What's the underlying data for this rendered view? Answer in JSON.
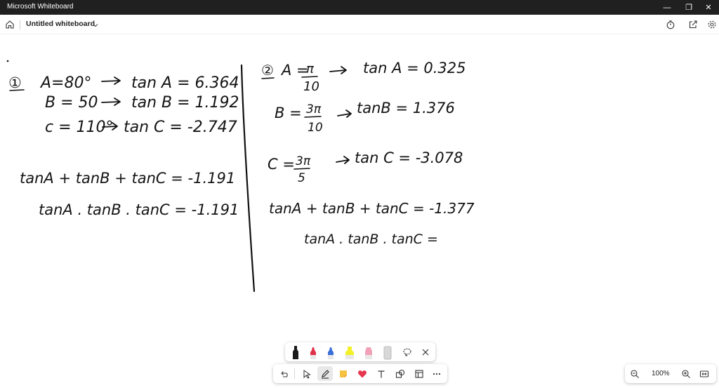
{
  "window": {
    "app_title": "Microsoft Whiteboard",
    "minimize_glyph": "—",
    "maximize_glyph": "❐",
    "close_glyph": "✕"
  },
  "toolbar": {
    "doc_title": "Untitled whiteboard",
    "icons": [
      "home-icon",
      "chevron-down-icon",
      "timer-icon",
      "share-icon",
      "settings-icon"
    ]
  },
  "canvas": {
    "left_section": {
      "marker": "①",
      "line1_left": "A=80°",
      "line1_right": "tan A = 6.364",
      "line2_left": "B = 50",
      "line2_right": "tan B = 1.192",
      "line3_left": "c = 110°",
      "line3_right": "tan C = -2.747",
      "sum_line": "tanA + tanB + tanC = -1.191",
      "product_line": "tanA . tanB . tanC = -1.191"
    },
    "right_section": {
      "marker": "②",
      "a_label": "A =",
      "a_numer": "π",
      "a_denom": "10",
      "a_result": "tan A = 0.325",
      "b_label": "B =",
      "b_numer": "3π",
      "b_denom": "10",
      "b_result": "tanB = 1.376",
      "c_label": "C =",
      "c_numer": "3π",
      "c_denom": "5",
      "c_result": "tan C = -3.078",
      "sum_line": "tanA + tanB + tanC = -1.377",
      "product_line": "tanA . tanB . tanC ="
    }
  },
  "pen_tray": {
    "pens": [
      {
        "name": "black-pen",
        "color": "#1a1a1a"
      },
      {
        "name": "red-pen",
        "color": "#e0304a"
      },
      {
        "name": "blue-pen",
        "color": "#3a6fd8"
      },
      {
        "name": "yellow-highlighter",
        "color": "#f4f02a"
      },
      {
        "name": "pink-highlighter",
        "color": "#f2a0b8"
      },
      {
        "name": "eraser",
        "color": "#d8d8d8"
      }
    ],
    "icons": [
      "lasso-icon",
      "close-icon"
    ]
  },
  "bottom_toolbar": {
    "icons": [
      "undo-icon",
      "select-icon",
      "pen-icon",
      "sticky-note-icon",
      "reactions-icon",
      "text-icon",
      "shapes-icon",
      "templates-icon",
      "more-icon"
    ]
  },
  "zoom": {
    "level": "100%",
    "icons": [
      "zoom-out-icon",
      "zoom-in-icon",
      "fit-to-screen-icon"
    ]
  }
}
